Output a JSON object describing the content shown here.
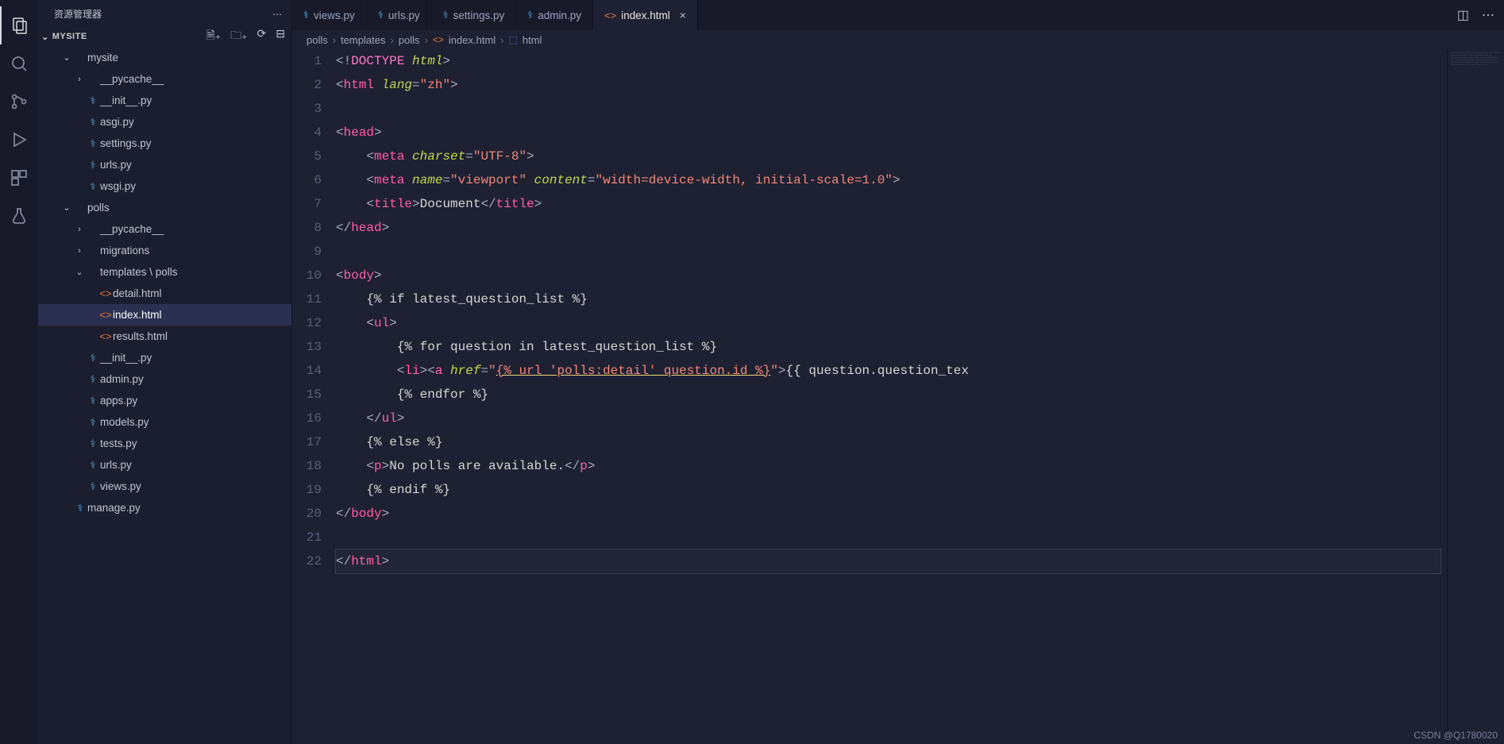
{
  "sidebar_title": "资源管理器",
  "project_name": "MYSITE",
  "tree": [
    {
      "d": 1,
      "t": "folder",
      "chev": "v",
      "label": "mysite"
    },
    {
      "d": 2,
      "t": "folder",
      "chev": ">",
      "label": "__pycache__"
    },
    {
      "d": 2,
      "t": "py",
      "label": "__init__.py"
    },
    {
      "d": 2,
      "t": "py",
      "label": "asgi.py"
    },
    {
      "d": 2,
      "t": "py",
      "label": "settings.py"
    },
    {
      "d": 2,
      "t": "py",
      "label": "urls.py"
    },
    {
      "d": 2,
      "t": "py",
      "label": "wsgi.py"
    },
    {
      "d": 1,
      "t": "folder",
      "chev": "v",
      "label": "polls"
    },
    {
      "d": 2,
      "t": "folder",
      "chev": ">",
      "label": "__pycache__"
    },
    {
      "d": 2,
      "t": "folder",
      "chev": ">",
      "label": "migrations"
    },
    {
      "d": 2,
      "t": "folder",
      "chev": "v",
      "label": "templates \\ polls"
    },
    {
      "d": 3,
      "t": "html",
      "label": "detail.html"
    },
    {
      "d": 3,
      "t": "html",
      "label": "index.html",
      "selected": true
    },
    {
      "d": 3,
      "t": "html",
      "label": "results.html"
    },
    {
      "d": 2,
      "t": "py",
      "label": "__init__.py"
    },
    {
      "d": 2,
      "t": "py",
      "label": "admin.py"
    },
    {
      "d": 2,
      "t": "py",
      "label": "apps.py"
    },
    {
      "d": 2,
      "t": "py",
      "label": "models.py"
    },
    {
      "d": 2,
      "t": "py",
      "label": "tests.py"
    },
    {
      "d": 2,
      "t": "py",
      "label": "urls.py"
    },
    {
      "d": 2,
      "t": "py",
      "label": "views.py"
    },
    {
      "d": 1,
      "t": "py",
      "label": "manage.py"
    }
  ],
  "tabs": [
    {
      "icon": "py",
      "label": "views.py"
    },
    {
      "icon": "py",
      "label": "urls.py"
    },
    {
      "icon": "py",
      "label": "settings.py"
    },
    {
      "icon": "py",
      "label": "admin.py"
    },
    {
      "icon": "html",
      "label": "index.html",
      "active": true
    }
  ],
  "breadcrumb": [
    "polls",
    "templates",
    "polls",
    "index.html",
    "html"
  ],
  "code": [
    [
      [
        "c-punc",
        "<!"
      ],
      [
        "c-kw",
        "DOCTYPE "
      ],
      [
        "c-attr",
        "html"
      ],
      [
        "c-punc",
        ">"
      ]
    ],
    [
      [
        "c-punc",
        "<"
      ],
      [
        "c-tag",
        "html "
      ],
      [
        "c-attr",
        "lang"
      ],
      [
        "c-punc",
        "="
      ],
      [
        "c-str",
        "\"zh\""
      ],
      [
        "c-punc",
        ">"
      ]
    ],
    [],
    [
      [
        "c-punc",
        "<"
      ],
      [
        "c-tag",
        "head"
      ],
      [
        "c-punc",
        ">"
      ]
    ],
    [
      [
        "",
        "    "
      ],
      [
        "c-punc",
        "<"
      ],
      [
        "c-tag",
        "meta "
      ],
      [
        "c-attr",
        "charset"
      ],
      [
        "c-punc",
        "="
      ],
      [
        "c-str",
        "\"UTF-8\""
      ],
      [
        "c-punc",
        ">"
      ]
    ],
    [
      [
        "",
        "    "
      ],
      [
        "c-punc",
        "<"
      ],
      [
        "c-tag",
        "meta "
      ],
      [
        "c-attr",
        "name"
      ],
      [
        "c-punc",
        "="
      ],
      [
        "c-str",
        "\"viewport\" "
      ],
      [
        "c-attr",
        "content"
      ],
      [
        "c-punc",
        "="
      ],
      [
        "c-str",
        "\"width=device-width, initial-scale=1.0\""
      ],
      [
        "c-punc",
        ">"
      ]
    ],
    [
      [
        "",
        "    "
      ],
      [
        "c-punc",
        "<"
      ],
      [
        "c-tag",
        "title"
      ],
      [
        "c-punc",
        ">"
      ],
      [
        "c-txt",
        "Document"
      ],
      [
        "c-punc",
        "</"
      ],
      [
        "c-tag",
        "title"
      ],
      [
        "c-punc",
        ">"
      ]
    ],
    [
      [
        "c-punc",
        "</"
      ],
      [
        "c-tag",
        "head"
      ],
      [
        "c-punc",
        ">"
      ]
    ],
    [],
    [
      [
        "c-punc",
        "<"
      ],
      [
        "c-tag",
        "body"
      ],
      [
        "c-punc",
        ">"
      ]
    ],
    [
      [
        "",
        "    "
      ],
      [
        "c-txt",
        "{% if latest_question_list %}"
      ]
    ],
    [
      [
        "",
        "    "
      ],
      [
        "c-punc",
        "<"
      ],
      [
        "c-tag",
        "ul"
      ],
      [
        "c-punc",
        ">"
      ]
    ],
    [
      [
        "",
        "        "
      ],
      [
        "c-txt",
        "{% for question in latest_question_list %}"
      ]
    ],
    [
      [
        "",
        "        "
      ],
      [
        "c-punc",
        "<"
      ],
      [
        "c-tag",
        "li"
      ],
      [
        "c-punc",
        "><"
      ],
      [
        "c-tag",
        "a "
      ],
      [
        "c-attr",
        "href"
      ],
      [
        "c-punc",
        "="
      ],
      [
        "c-str",
        "\""
      ],
      [
        "c-str c-underline",
        "{% url 'polls:detail' question.id %}"
      ],
      [
        "c-str",
        "\""
      ],
      [
        "c-punc",
        ">"
      ],
      [
        "c-txt",
        "{{ question.question_tex"
      ]
    ],
    [
      [
        "",
        "        "
      ],
      [
        "c-txt",
        "{% endfor %}"
      ]
    ],
    [
      [
        "",
        "    "
      ],
      [
        "c-punc",
        "</"
      ],
      [
        "c-tag",
        "ul"
      ],
      [
        "c-punc",
        ">"
      ]
    ],
    [
      [
        "",
        "    "
      ],
      [
        "c-txt",
        "{% else %}"
      ]
    ],
    [
      [
        "",
        "    "
      ],
      [
        "c-punc",
        "<"
      ],
      [
        "c-tag",
        "p"
      ],
      [
        "c-punc",
        ">"
      ],
      [
        "c-txt",
        "No polls are available."
      ],
      [
        "c-punc",
        "</"
      ],
      [
        "c-tag",
        "p"
      ],
      [
        "c-punc",
        ">"
      ]
    ],
    [
      [
        "",
        "    "
      ],
      [
        "c-txt",
        "{% endif %}"
      ]
    ],
    [
      [
        "c-punc",
        "</"
      ],
      [
        "c-tag",
        "body"
      ],
      [
        "c-punc",
        ">"
      ]
    ],
    [],
    [
      [
        "c-punc",
        "</"
      ],
      [
        "c-tag",
        "html"
      ],
      [
        "c-punc",
        ">"
      ]
    ]
  ],
  "active_line": 22,
  "watermark": "CSDN @Q1780020"
}
